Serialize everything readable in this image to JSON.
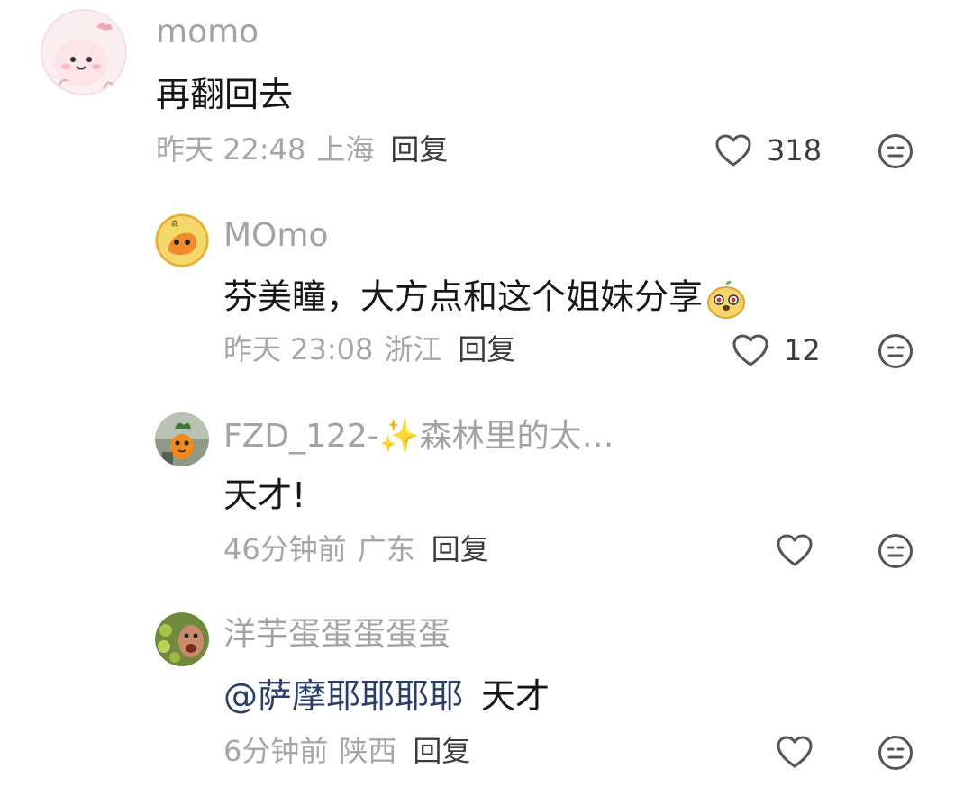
{
  "comments": [
    {
      "username": "momo",
      "text": "再翻回去",
      "time": "昨天 22:48",
      "location": "上海",
      "reply_label": "回复",
      "likes": "318"
    },
    {
      "username": "MOmo",
      "text": "芬美瞳，大方点和这个姐妹分享",
      "time": "昨天 23:08",
      "location": "浙江",
      "reply_label": "回复",
      "likes": "12"
    },
    {
      "username": "FZD_122-✨森林里的太…",
      "text": "天才!",
      "time": "46分钟前",
      "location": "广东",
      "reply_label": "回复",
      "likes": ""
    },
    {
      "username": "洋芋蛋蛋蛋蛋蛋",
      "mention": "@萨摩耶耶耶耶",
      "text": "天才",
      "time": "6分钟前",
      "location": "陕西",
      "reply_label": "回复",
      "likes": ""
    }
  ],
  "icons": {
    "like": "heart-outline-icon",
    "dislike": "neutral-face-icon"
  },
  "colors": {
    "username": "#a3a3a3",
    "text": "#161616",
    "meta": "#a6a6a6",
    "reply": "#3c3c3c",
    "mention": "#2b3f66",
    "icon": "#555555"
  }
}
